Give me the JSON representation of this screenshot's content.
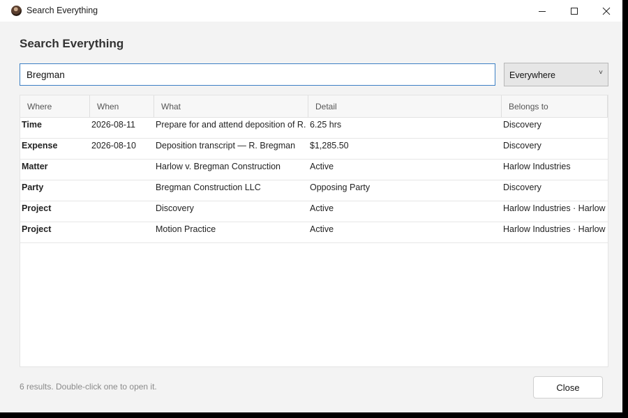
{
  "window": {
    "title": "Search Everything",
    "controls": {
      "minimize": "minimize-icon",
      "maximize": "maximize-icon",
      "close": "close-icon"
    }
  },
  "dialog": {
    "heading": "Search Everything",
    "search": {
      "value": "Bregman"
    },
    "scope": {
      "selected": "Everywhere"
    },
    "columns": [
      "Where",
      "When",
      "What",
      "Detail",
      "Belongs to"
    ],
    "rows": [
      {
        "where": "Time",
        "when": "2026-08-11",
        "what": "Prepare for and attend deposition of R.",
        "detail": "6.25 hrs",
        "belongs": "Discovery"
      },
      {
        "where": "Expense",
        "when": "2026-08-10",
        "what": "Deposition transcript — R. Bregman",
        "detail": "$1,285.50",
        "belongs": "Discovery"
      },
      {
        "where": "Matter",
        "when": "",
        "what": "Harlow v. Bregman Construction",
        "detail": "Active",
        "belongs": "Harlow Industries"
      },
      {
        "where": "Party",
        "when": "",
        "what": "Bregman Construction LLC",
        "detail": "Opposing Party",
        "belongs": "Discovery"
      },
      {
        "where": "Project",
        "when": "",
        "what": "Discovery",
        "detail": "Active",
        "belongs": "Harlow Industries · Harlow"
      },
      {
        "where": "Project",
        "when": "",
        "what": "Motion Practice",
        "detail": "Active",
        "belongs": "Harlow Industries · Harlow"
      }
    ],
    "status": "6 results. Double-click one to open it.",
    "close_label": "Close"
  }
}
